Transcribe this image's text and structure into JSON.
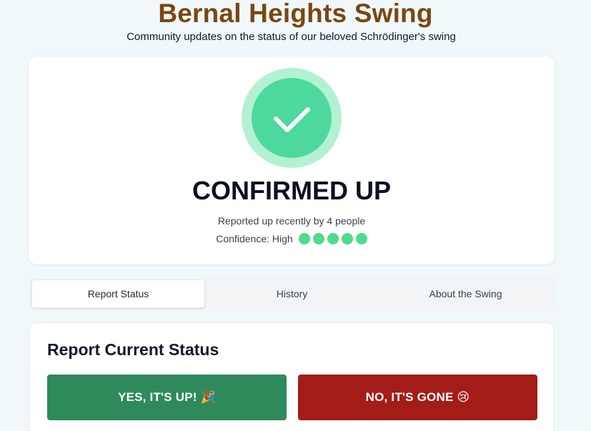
{
  "header": {
    "title": "Bernal Heights Swing",
    "subtitle": "Community updates on the status of our beloved Schrödinger's swing"
  },
  "status": {
    "icon": "check-icon",
    "label": "CONFIRMED UP",
    "reported": "Reported up recently by 4 people",
    "confidence_label": "Confidence: High",
    "confidence_level": 5,
    "confidence_max": 5,
    "colors": {
      "ring": "#b3f1d2",
      "circle": "#4dd99e",
      "dot": "#4fdb8d"
    }
  },
  "tabs": [
    {
      "label": "Report Status",
      "active": true
    },
    {
      "label": "History",
      "active": false
    },
    {
      "label": "About the Swing",
      "active": false
    }
  ],
  "report": {
    "heading": "Report Current Status",
    "yes_label": "YES, IT'S UP! 🎉",
    "no_label": "NO, IT'S GONE 😢",
    "colors": {
      "yes": "#2e8a5b",
      "no": "#a31c18"
    }
  },
  "colors": {
    "title": "#7a4710",
    "background": "#f1f8fb"
  }
}
